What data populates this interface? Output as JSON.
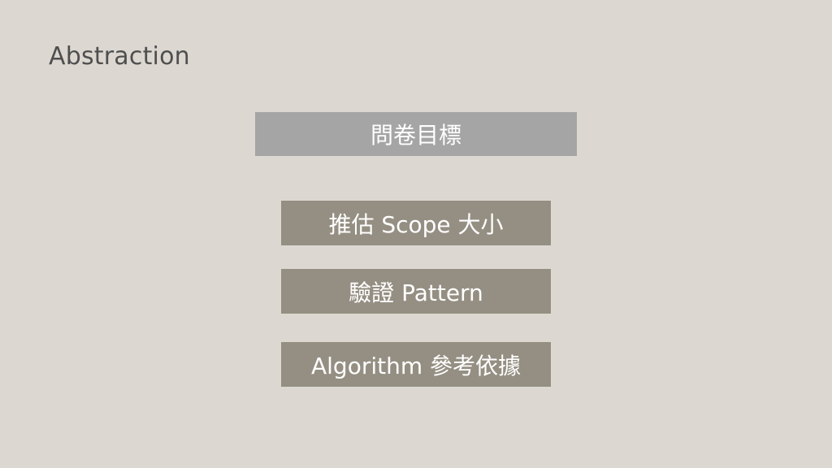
{
  "slide": {
    "title": "Abstraction",
    "goal_box": "問卷目標",
    "items": [
      "推估 Scope 大小",
      "驗證 Pattern",
      "Algorithm 參考依據"
    ]
  },
  "colors": {
    "background": "#dcd8d1",
    "title_text": "#4f4f4f",
    "goal_box": "#a5a5a5",
    "item_box": "#958f83",
    "box_text": "#ffffff"
  }
}
